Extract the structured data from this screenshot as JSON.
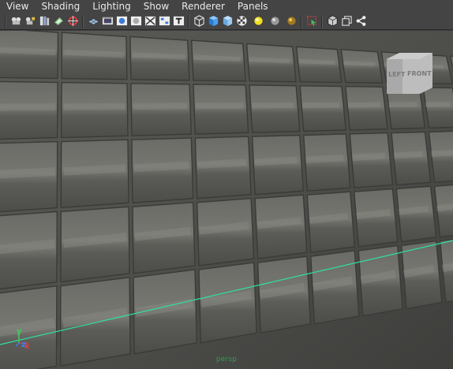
{
  "menubar": {
    "items": [
      {
        "label": "View"
      },
      {
        "label": "Shading"
      },
      {
        "label": "Lighting"
      },
      {
        "label": "Show"
      },
      {
        "label": "Renderer"
      },
      {
        "label": "Panels"
      }
    ]
  },
  "toolbar": {
    "groups": [
      [
        "select-camera-icon",
        "lock-camera-icon",
        "bookmarks-icon",
        "image-plane-icon",
        "2d-pan-zoom-icon"
      ],
      [
        "grid-icon",
        "film-gate-icon",
        "resolution-gate-icon",
        "gate-mask-icon",
        "field-chart-icon",
        "safe-action-icon",
        "safe-title-icon"
      ],
      [
        "wireframe-icon",
        "smooth-shade-icon",
        "default-material-icon",
        "textured-icon",
        "use-all-lights-icon",
        "shadows-icon",
        "ambient-occlusion-icon"
      ],
      [
        "isolate-select-icon"
      ],
      [
        "xray-icon",
        "xray-active-components-icon",
        "share-icon"
      ]
    ]
  },
  "viewport": {
    "camera": "persp",
    "viewcube": {
      "left_face": "LEFT",
      "front_face": "FRONT"
    },
    "axis": {
      "x": "x",
      "y": "y",
      "z": "z"
    },
    "colors": {
      "grid_line": "#2fe0a0",
      "axis_x": "#e04040",
      "axis_y": "#40d060",
      "axis_z": "#4080ff",
      "camera_label": "#3b9a55"
    }
  }
}
